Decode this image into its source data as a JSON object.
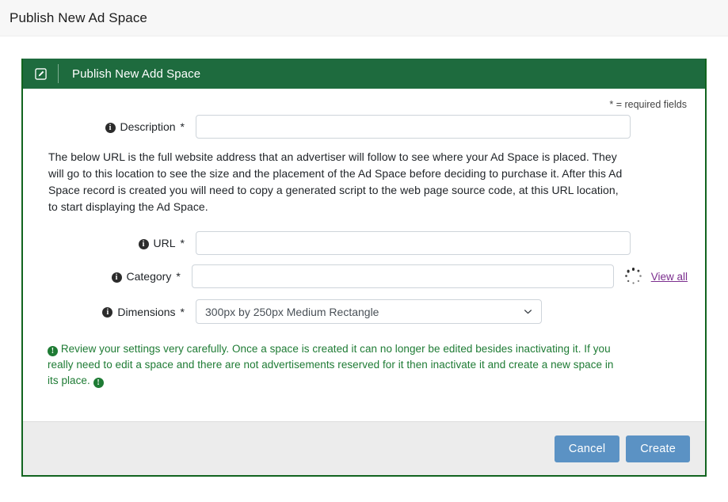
{
  "topbar": {
    "title": "Publish New Ad Space"
  },
  "card": {
    "header": {
      "icon": "edit-square-icon",
      "title": "Publish New Add Space"
    },
    "required_note": "* = required fields",
    "fields": {
      "description": {
        "label": "Description",
        "required_mark": "*",
        "value": "",
        "placeholder": "",
        "info_icon": "info-circle-icon"
      },
      "url": {
        "label": "URL",
        "required_mark": "*",
        "value": "",
        "placeholder": "",
        "info_icon": "info-circle-icon"
      },
      "category": {
        "label": "Category",
        "required_mark": "*",
        "value": "",
        "placeholder": "",
        "info_icon": "info-circle-icon",
        "spinner": "loading-spinner-icon",
        "view_all_label": "View all"
      },
      "dimensions": {
        "label": "Dimensions",
        "required_mark": "*",
        "selected": "300px by 250px Medium Rectangle",
        "info_icon": "info-circle-icon",
        "chevron": "chevron-down-icon"
      }
    },
    "paragraph": "The below URL is the full website address that an advertiser will follow to see where your Ad Space is placed. They will go to this location to see the size and the placement of the Ad Space before deciding to purchase it. After this Ad Space record is created you will need to copy a generated script to the web page source code, at this URL location, to start displaying the Ad Space.",
    "warning": {
      "icon_leading": "exclamation-circle-icon",
      "icon_trailing": "exclamation-circle-icon",
      "text": "Review your settings very carefully. Once a space is created it can no longer be edited besides inactivating it. If you really need to edit a space and there are not advertisements reserved for it then inactivate it and create a new space in its place."
    },
    "footer": {
      "cancel_label": "Cancel",
      "create_label": "Create"
    }
  },
  "colors": {
    "header_green": "#1e6b3e",
    "border_green": "#11641f",
    "warning_green": "#1e7b34",
    "button_blue": "#5b92c4",
    "link_purple": "#7b2d8e",
    "footer_gray": "#ececec",
    "topbar_gray": "#f7f7f7"
  }
}
